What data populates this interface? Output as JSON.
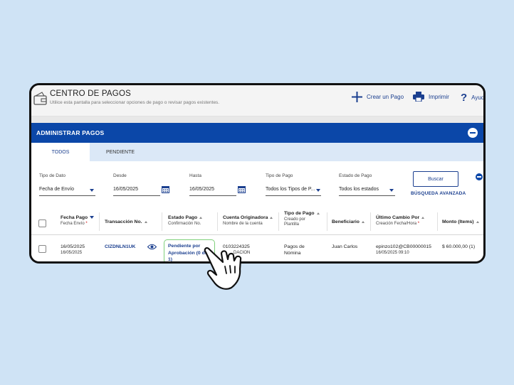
{
  "header": {
    "title": "CENTRO DE PAGOS",
    "subtitle": "Utilice esta pantalla para seleccionar opciones de pago o revisar pagos existentes.",
    "actions": {
      "create": "Crear un Pago",
      "print": "Imprimir",
      "help": "Ayuda"
    }
  },
  "panel": {
    "title": "ADMINISTRAR PAGOS"
  },
  "tabs": [
    {
      "label": "TODOS",
      "active": true
    },
    {
      "label": "PENDIENTE",
      "active": false
    }
  ],
  "filters": {
    "tipo_dato": {
      "label": "Tipo de Dato",
      "value": "Fecha de Envío"
    },
    "desde": {
      "label": "Desde",
      "value": "16/05/2025"
    },
    "hasta": {
      "label": "Hasta",
      "value": "16/05/2025"
    },
    "tipo_pago": {
      "label": "Tipo de Pago",
      "value": "Todos los Tipos de P..."
    },
    "estado_pago": {
      "label": "Estado de Pago",
      "value": "Todos los estados"
    },
    "search_button": "Buscar",
    "advanced_search": "BÚSQUEDA AVANZADA"
  },
  "table": {
    "columns": [
      {
        "title": "Fecha Pago",
        "sub": "Fecha Envío",
        "required": "*"
      },
      {
        "title": "Transacción No.",
        "sub": ""
      },
      {
        "title": "Estado Pago",
        "sub": "Confirmación No."
      },
      {
        "title": "Cuenta Originadora",
        "sub": "Nombre de la cuenta"
      },
      {
        "title": "Tipo de Pago",
        "sub": "Creado por",
        "sub2": "Plantilla"
      },
      {
        "title": "Beneficiario",
        "sub": ""
      },
      {
        "title": "Último Cambio Por",
        "sub": "Creación Fecha/Hora",
        "required": "*"
      },
      {
        "title": "Monto (Items)",
        "sub": ""
      }
    ],
    "rows": [
      {
        "fecha_pago": "16/05/2025",
        "fecha_envio": "16/05/2025",
        "transaccion": "CIZDNLN1UK",
        "estado_line1": "Pendiente por",
        "estado_line2": "Aprobación (0 de",
        "estado_line3": "1)",
        "cuenta": "0103224325",
        "cuenta_nombre": "DACION",
        "tipo_pago_line1": "Pagos de",
        "tipo_pago_line2": "Nómina",
        "beneficiario": "Juan Carlos",
        "ultimo_cambio": "epinzo102@CB00000015",
        "creacion": "16/05/2025 09:10",
        "monto": "$ 60.000,00 (1)"
      }
    ]
  },
  "colors": {
    "primary": "#0b47a8",
    "link": "#1b3f8f",
    "status_border": "#7fd07a",
    "background": "#cfe3f5"
  }
}
